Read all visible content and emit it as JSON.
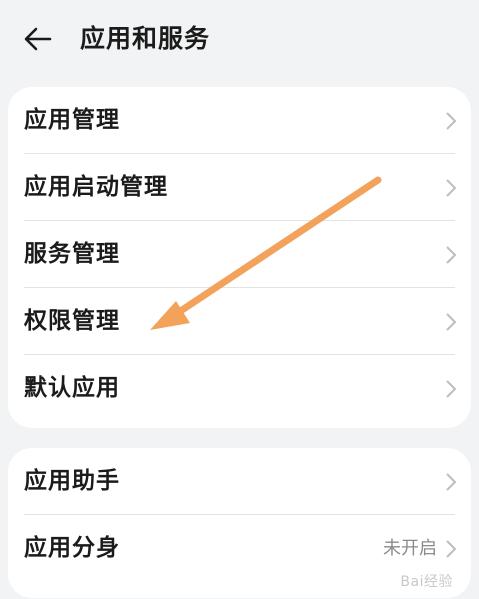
{
  "header": {
    "back_icon": "arrow-left-icon",
    "title": "应用和服务"
  },
  "groups": [
    {
      "items": [
        {
          "label": "应用管理"
        },
        {
          "label": "应用启动管理"
        },
        {
          "label": "服务管理"
        },
        {
          "label": "权限管理"
        },
        {
          "label": "默认应用"
        }
      ]
    },
    {
      "items": [
        {
          "label": "应用助手"
        },
        {
          "label": "应用分身",
          "value": "未开启"
        }
      ]
    }
  ],
  "annotation": {
    "arrow_color": "#f2a25a"
  },
  "watermark": {
    "text": "Bai经验"
  },
  "colors": {
    "background": "#f1f3f5",
    "card": "#ffffff",
    "text": "#1b1b1b",
    "secondary_text": "#8b8b8b",
    "chevron": "#bdbdbd"
  }
}
